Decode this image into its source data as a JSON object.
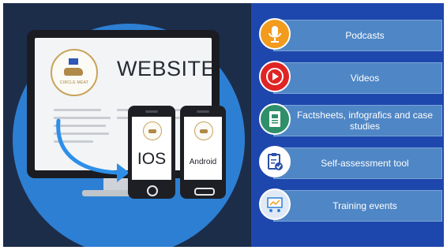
{
  "website": {
    "title": "WEBSITE",
    "logo_text": "CIRCLE MEAT"
  },
  "mobile": {
    "ios_label": "IOS",
    "android_label": "Android"
  },
  "features": [
    {
      "label": "Podcasts",
      "icon": "microphone-icon",
      "icon_color": "#f29b1d"
    },
    {
      "label": "Videos",
      "icon": "play-icon",
      "icon_color": "#e02424"
    },
    {
      "label": "Factsheets, infografics and case studies",
      "icon": "document-icon",
      "icon_color": "#2f8f6a"
    },
    {
      "label": "Self-assessment tool",
      "icon": "clipboard-check-icon",
      "icon_color": "#2b4fa8"
    },
    {
      "label": "Training events",
      "icon": "presentation-board-icon",
      "icon_color": "#dfeaf6"
    }
  ],
  "colors": {
    "left_background": "#1c2d4a",
    "circle": "#2d7fd3",
    "right_background": "#1e47ad",
    "feature_bar": "#4f86c5"
  }
}
